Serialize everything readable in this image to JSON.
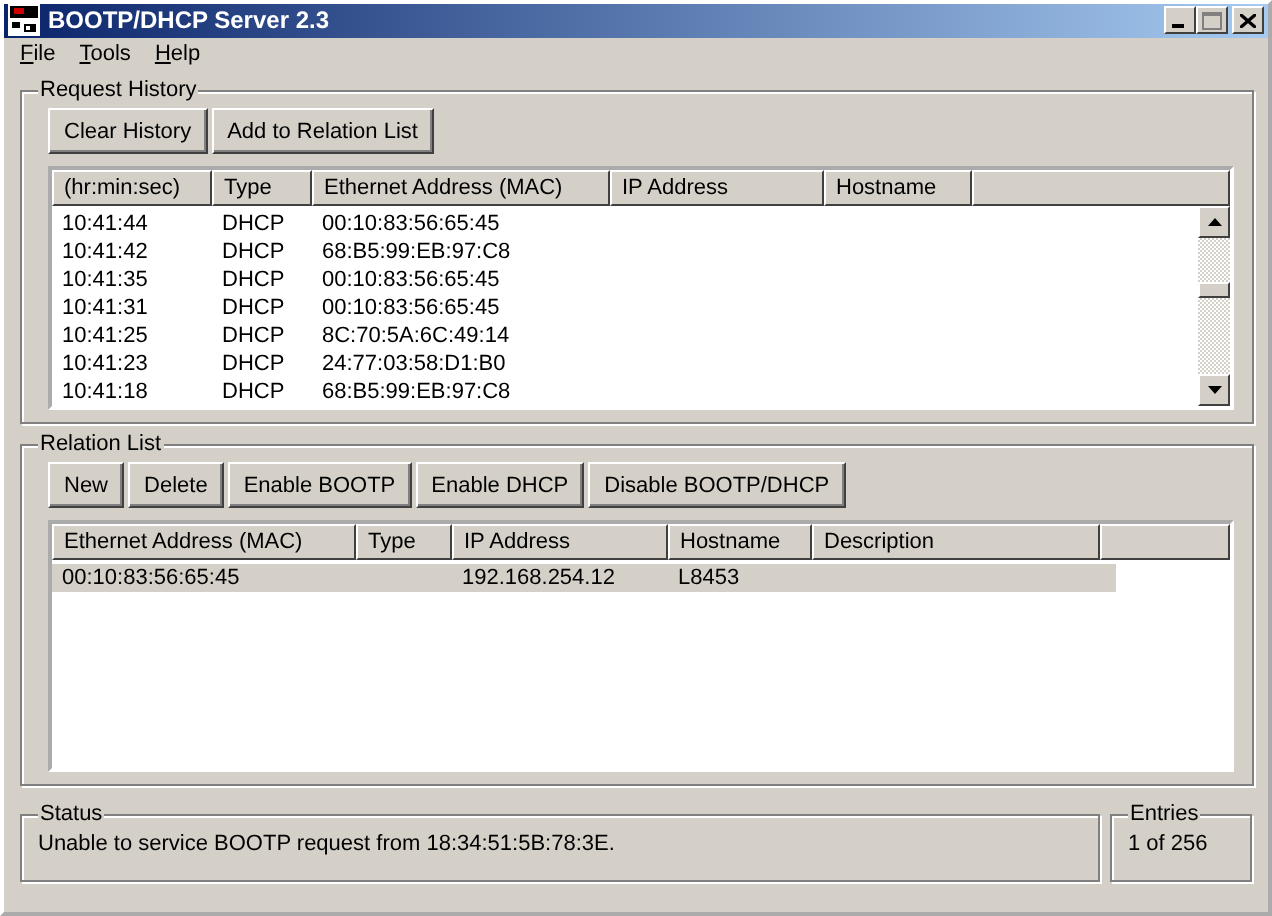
{
  "window": {
    "title": "BOOTP/DHCP Server 2.3"
  },
  "menu": [
    "File",
    "Tools",
    "Help"
  ],
  "request_history": {
    "title": "Request History",
    "buttons": [
      "Clear History",
      "Add to Relation List"
    ],
    "columns": [
      "(hr:min:sec)",
      "Type",
      "Ethernet Address (MAC)",
      "IP Address",
      "Hostname"
    ],
    "rows": [
      {
        "time": "10:41:44",
        "type": "DHCP",
        "mac": "00:10:83:56:65:45"
      },
      {
        "time": "10:41:42",
        "type": "DHCP",
        "mac": "68:B5:99:EB:97:C8"
      },
      {
        "time": "10:41:35",
        "type": "DHCP",
        "mac": "00:10:83:56:65:45"
      },
      {
        "time": "10:41:31",
        "type": "DHCP",
        "mac": "00:10:83:56:65:45"
      },
      {
        "time": "10:41:25",
        "type": "DHCP",
        "mac": "8C:70:5A:6C:49:14"
      },
      {
        "time": "10:41:23",
        "type": "DHCP",
        "mac": "24:77:03:58:D1:B0"
      },
      {
        "time": "10:41:18",
        "type": "DHCP",
        "mac": "68:B5:99:EB:97:C8"
      }
    ]
  },
  "relation_list": {
    "title": "Relation List",
    "buttons": [
      "New",
      "Delete",
      "Enable BOOTP",
      "Enable DHCP",
      "Disable BOOTP/DHCP"
    ],
    "columns": [
      "Ethernet Address (MAC)",
      "Type",
      "IP Address",
      "Hostname",
      "Description"
    ],
    "rows": [
      {
        "mac": "00:10:83:56:65:45",
        "type": "",
        "ip": "192.168.254.12",
        "hostname": "L8453",
        "description": "",
        "selected": true
      }
    ]
  },
  "status": {
    "title": "Status",
    "text": "Unable to service BOOTP request from 18:34:51:5B:78:3E."
  },
  "entries": {
    "title": "Entries",
    "text": "1 of 256"
  }
}
